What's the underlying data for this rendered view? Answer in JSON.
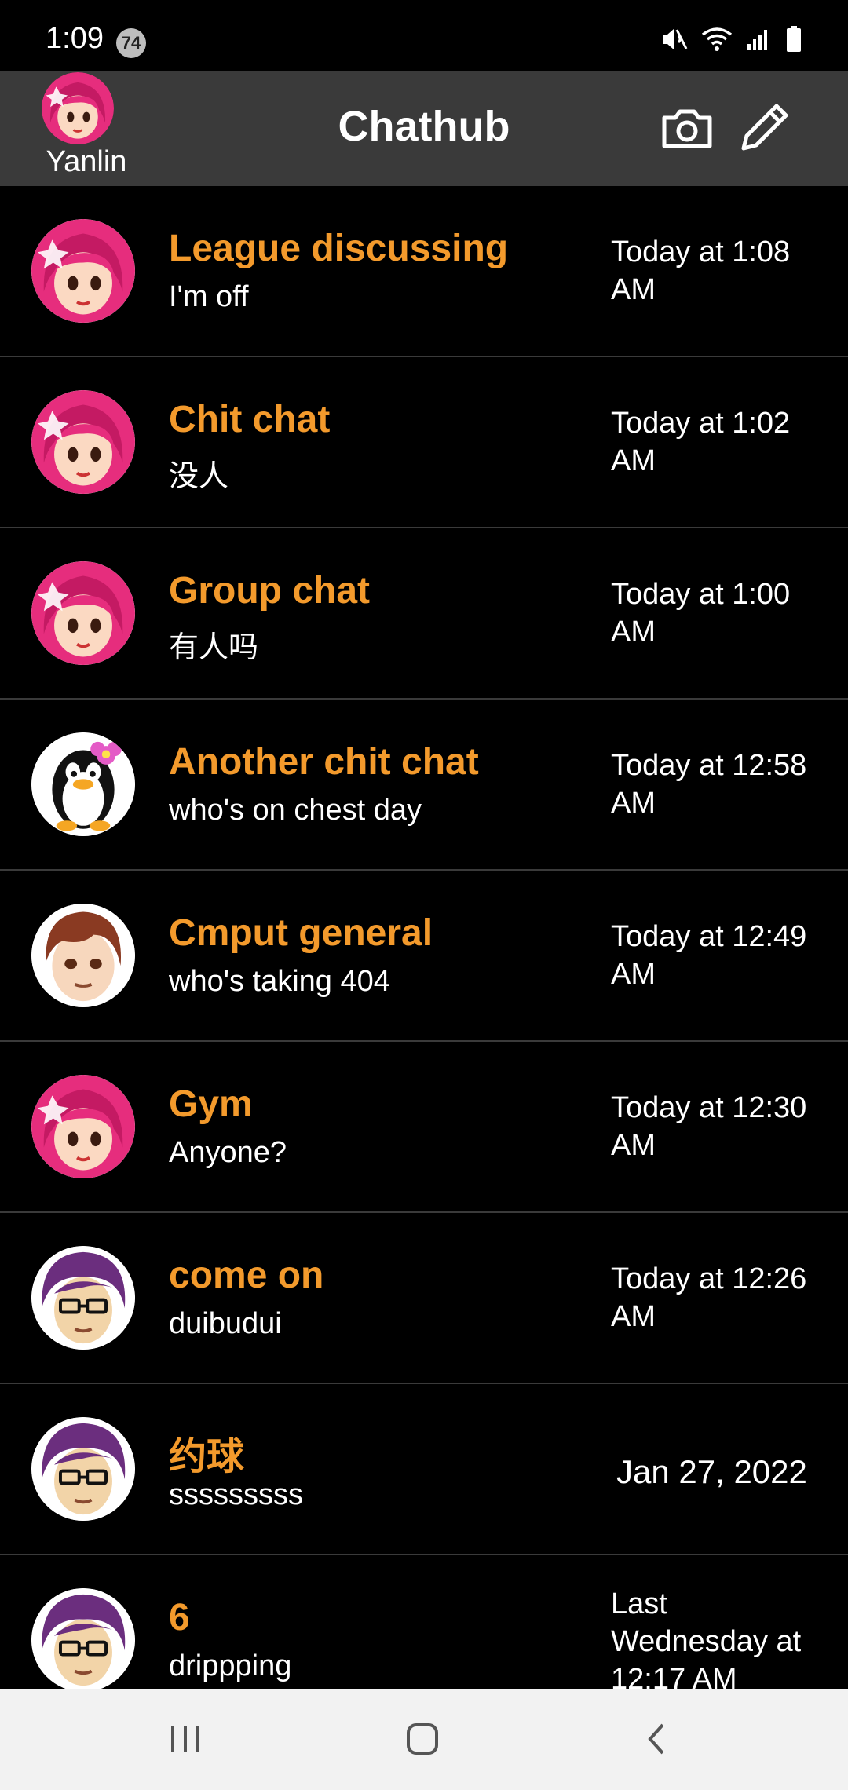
{
  "status": {
    "time": "1:09",
    "badge": "74"
  },
  "header": {
    "profile_name": "Yanlin",
    "title": "Chathub"
  },
  "colors": {
    "accent": "#f39a2c",
    "appbar": "#3a3a3a",
    "background": "#000000"
  },
  "chats": [
    {
      "title": "League discussing",
      "message": "I'm off",
      "time": "Today at 1:08 AM",
      "avatar": "pink-hair-girl"
    },
    {
      "title": "Chit chat",
      "message": "没人",
      "time": "Today at 1:02 AM",
      "avatar": "pink-hair-girl"
    },
    {
      "title": "Group chat",
      "message": "有人吗",
      "time": "Today at 1:00 AM",
      "avatar": "pink-hair-girl"
    },
    {
      "title": "Another chit chat",
      "message": "who's on chest day",
      "time": "Today at 12:58 AM",
      "avatar": "penguin"
    },
    {
      "title": "Cmput general",
      "message": "who's taking 404",
      "time": "Today at 12:49 AM",
      "avatar": "brown-hair-boy"
    },
    {
      "title": "Gym",
      "message": "Anyone?",
      "time": "Today at 12:30 AM",
      "avatar": "pink-hair-girl"
    },
    {
      "title": "come on",
      "message": "duibudui",
      "time": "Today at 12:26 AM",
      "avatar": "purple-hair-glasses"
    },
    {
      "title": "约球",
      "message": "sssssssss",
      "time": "Jan 27, 2022",
      "avatar": "purple-hair-glasses"
    },
    {
      "title": "6",
      "message": "drippping",
      "time": "Last Wednesday at 12:17 AM",
      "avatar": "purple-hair-glasses"
    }
  ]
}
